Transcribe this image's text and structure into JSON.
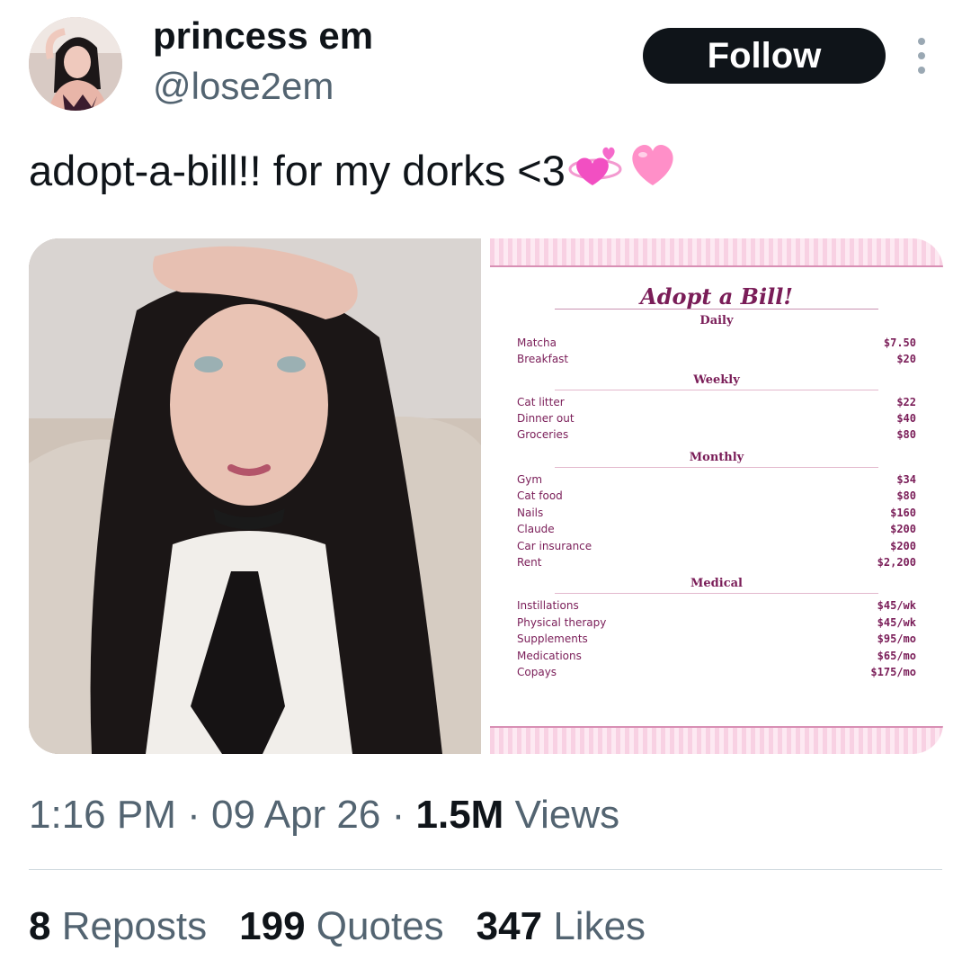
{
  "author": {
    "display_name": "princess em",
    "handle": "@lose2em",
    "follow_label": "Follow"
  },
  "tweet": {
    "text": "adopt-a-bill!! for my dorks <3",
    "emojis": [
      "revolving-hearts-emoji",
      "pink-heart-emoji"
    ]
  },
  "bill": {
    "title": "Adopt a Bill!",
    "sections": [
      {
        "name": "Daily",
        "items": [
          {
            "label": "Matcha",
            "amount": "$7.50"
          },
          {
            "label": "Breakfast",
            "amount": "$20"
          }
        ]
      },
      {
        "name": "Weekly",
        "items": [
          {
            "label": "Cat litter",
            "amount": "$22"
          },
          {
            "label": "Dinner out",
            "amount": "$40"
          },
          {
            "label": "Groceries",
            "amount": "$80"
          }
        ]
      },
      {
        "name": "Monthly",
        "items": [
          {
            "label": "Gym",
            "amount": "$34"
          },
          {
            "label": "Cat food",
            "amount": "$80"
          },
          {
            "label": "Nails",
            "amount": "$160"
          },
          {
            "label": "Claude",
            "amount": "$200"
          },
          {
            "label": "Car insurance",
            "amount": "$200"
          },
          {
            "label": "Rent",
            "amount": "$2,200"
          }
        ]
      },
      {
        "name": "Medical",
        "items": [
          {
            "label": "Instillations",
            "amount": "$45/wk"
          },
          {
            "label": "Physical therapy",
            "amount": "$45/wk"
          },
          {
            "label": "Supplements",
            "amount": "$95/mo"
          },
          {
            "label": "Medications",
            "amount": "$65/mo"
          },
          {
            "label": "Copays",
            "amount": "$175/mo"
          }
        ]
      }
    ]
  },
  "meta": {
    "time": "1:16 PM",
    "date": "09 Apr 26",
    "views_count": "1.5M",
    "views_label": "Views"
  },
  "stats": {
    "reposts_count": "8",
    "reposts_label": "Reposts",
    "quotes_count": "199",
    "quotes_label": "Quotes",
    "likes_count": "347",
    "likes_label": "Likes"
  },
  "colors": {
    "follow_bg": "#0f1419",
    "secondary_text": "#536471",
    "bill_accent": "#7a1d58",
    "bill_stripe": "#f8d1e3"
  }
}
